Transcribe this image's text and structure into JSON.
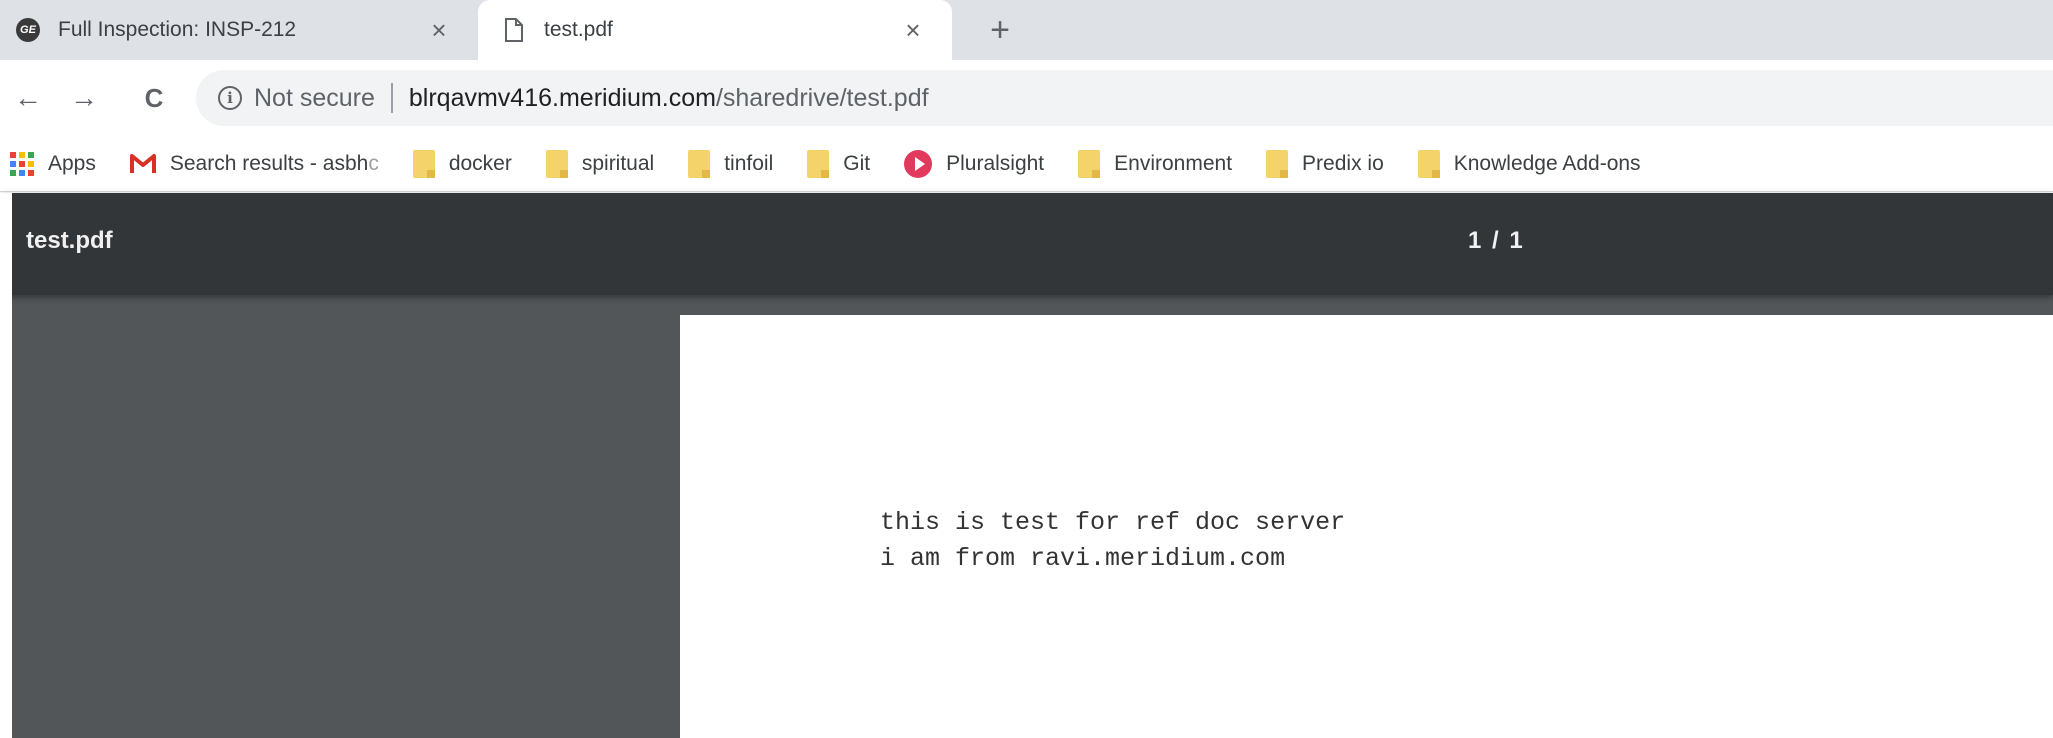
{
  "tabs": [
    {
      "title": "Full Inspection: INSP-212",
      "favicon": "ge-logo-icon",
      "active": false,
      "close": "×"
    },
    {
      "title": "test.pdf",
      "favicon": "file-icon",
      "active": true,
      "close": "×"
    }
  ],
  "new_tab": "+",
  "toolbar": {
    "back": "←",
    "forward": "→",
    "reload": "C",
    "security_icon": "i",
    "security_text": "Not secure",
    "url_host": "blrqavmv416.meridium.com",
    "url_path": "/sharedrive/test.pdf"
  },
  "bookmarks": [
    {
      "label": "Apps",
      "icon": "apps-grid-icon"
    },
    {
      "label": "Search results - asbh",
      "label_fade": "c",
      "icon": "gmail-icon"
    },
    {
      "label": "docker",
      "icon": "folder-icon"
    },
    {
      "label": "spiritual",
      "icon": "folder-icon"
    },
    {
      "label": "tinfoil",
      "icon": "folder-icon"
    },
    {
      "label": "Git",
      "icon": "folder-icon"
    },
    {
      "label": "Pluralsight",
      "icon": "pluralsight-icon"
    },
    {
      "label": "Environment",
      "icon": "folder-icon"
    },
    {
      "label": "Predix io",
      "icon": "folder-icon"
    },
    {
      "label": "Knowledge Add-ons",
      "icon": "folder-icon"
    }
  ],
  "pdf": {
    "title": "test.pdf",
    "page_indicator": "1 / 1",
    "lines": [
      "this is test for ref doc server",
      "i am from ravi.meridium.com"
    ]
  },
  "colors": {
    "tabstrip": "#dee1e6",
    "pdf_toolbar": "#323639",
    "pdf_canvas": "#525659",
    "folder": "#f4d36a",
    "pluralsight": "#e23a5e"
  }
}
